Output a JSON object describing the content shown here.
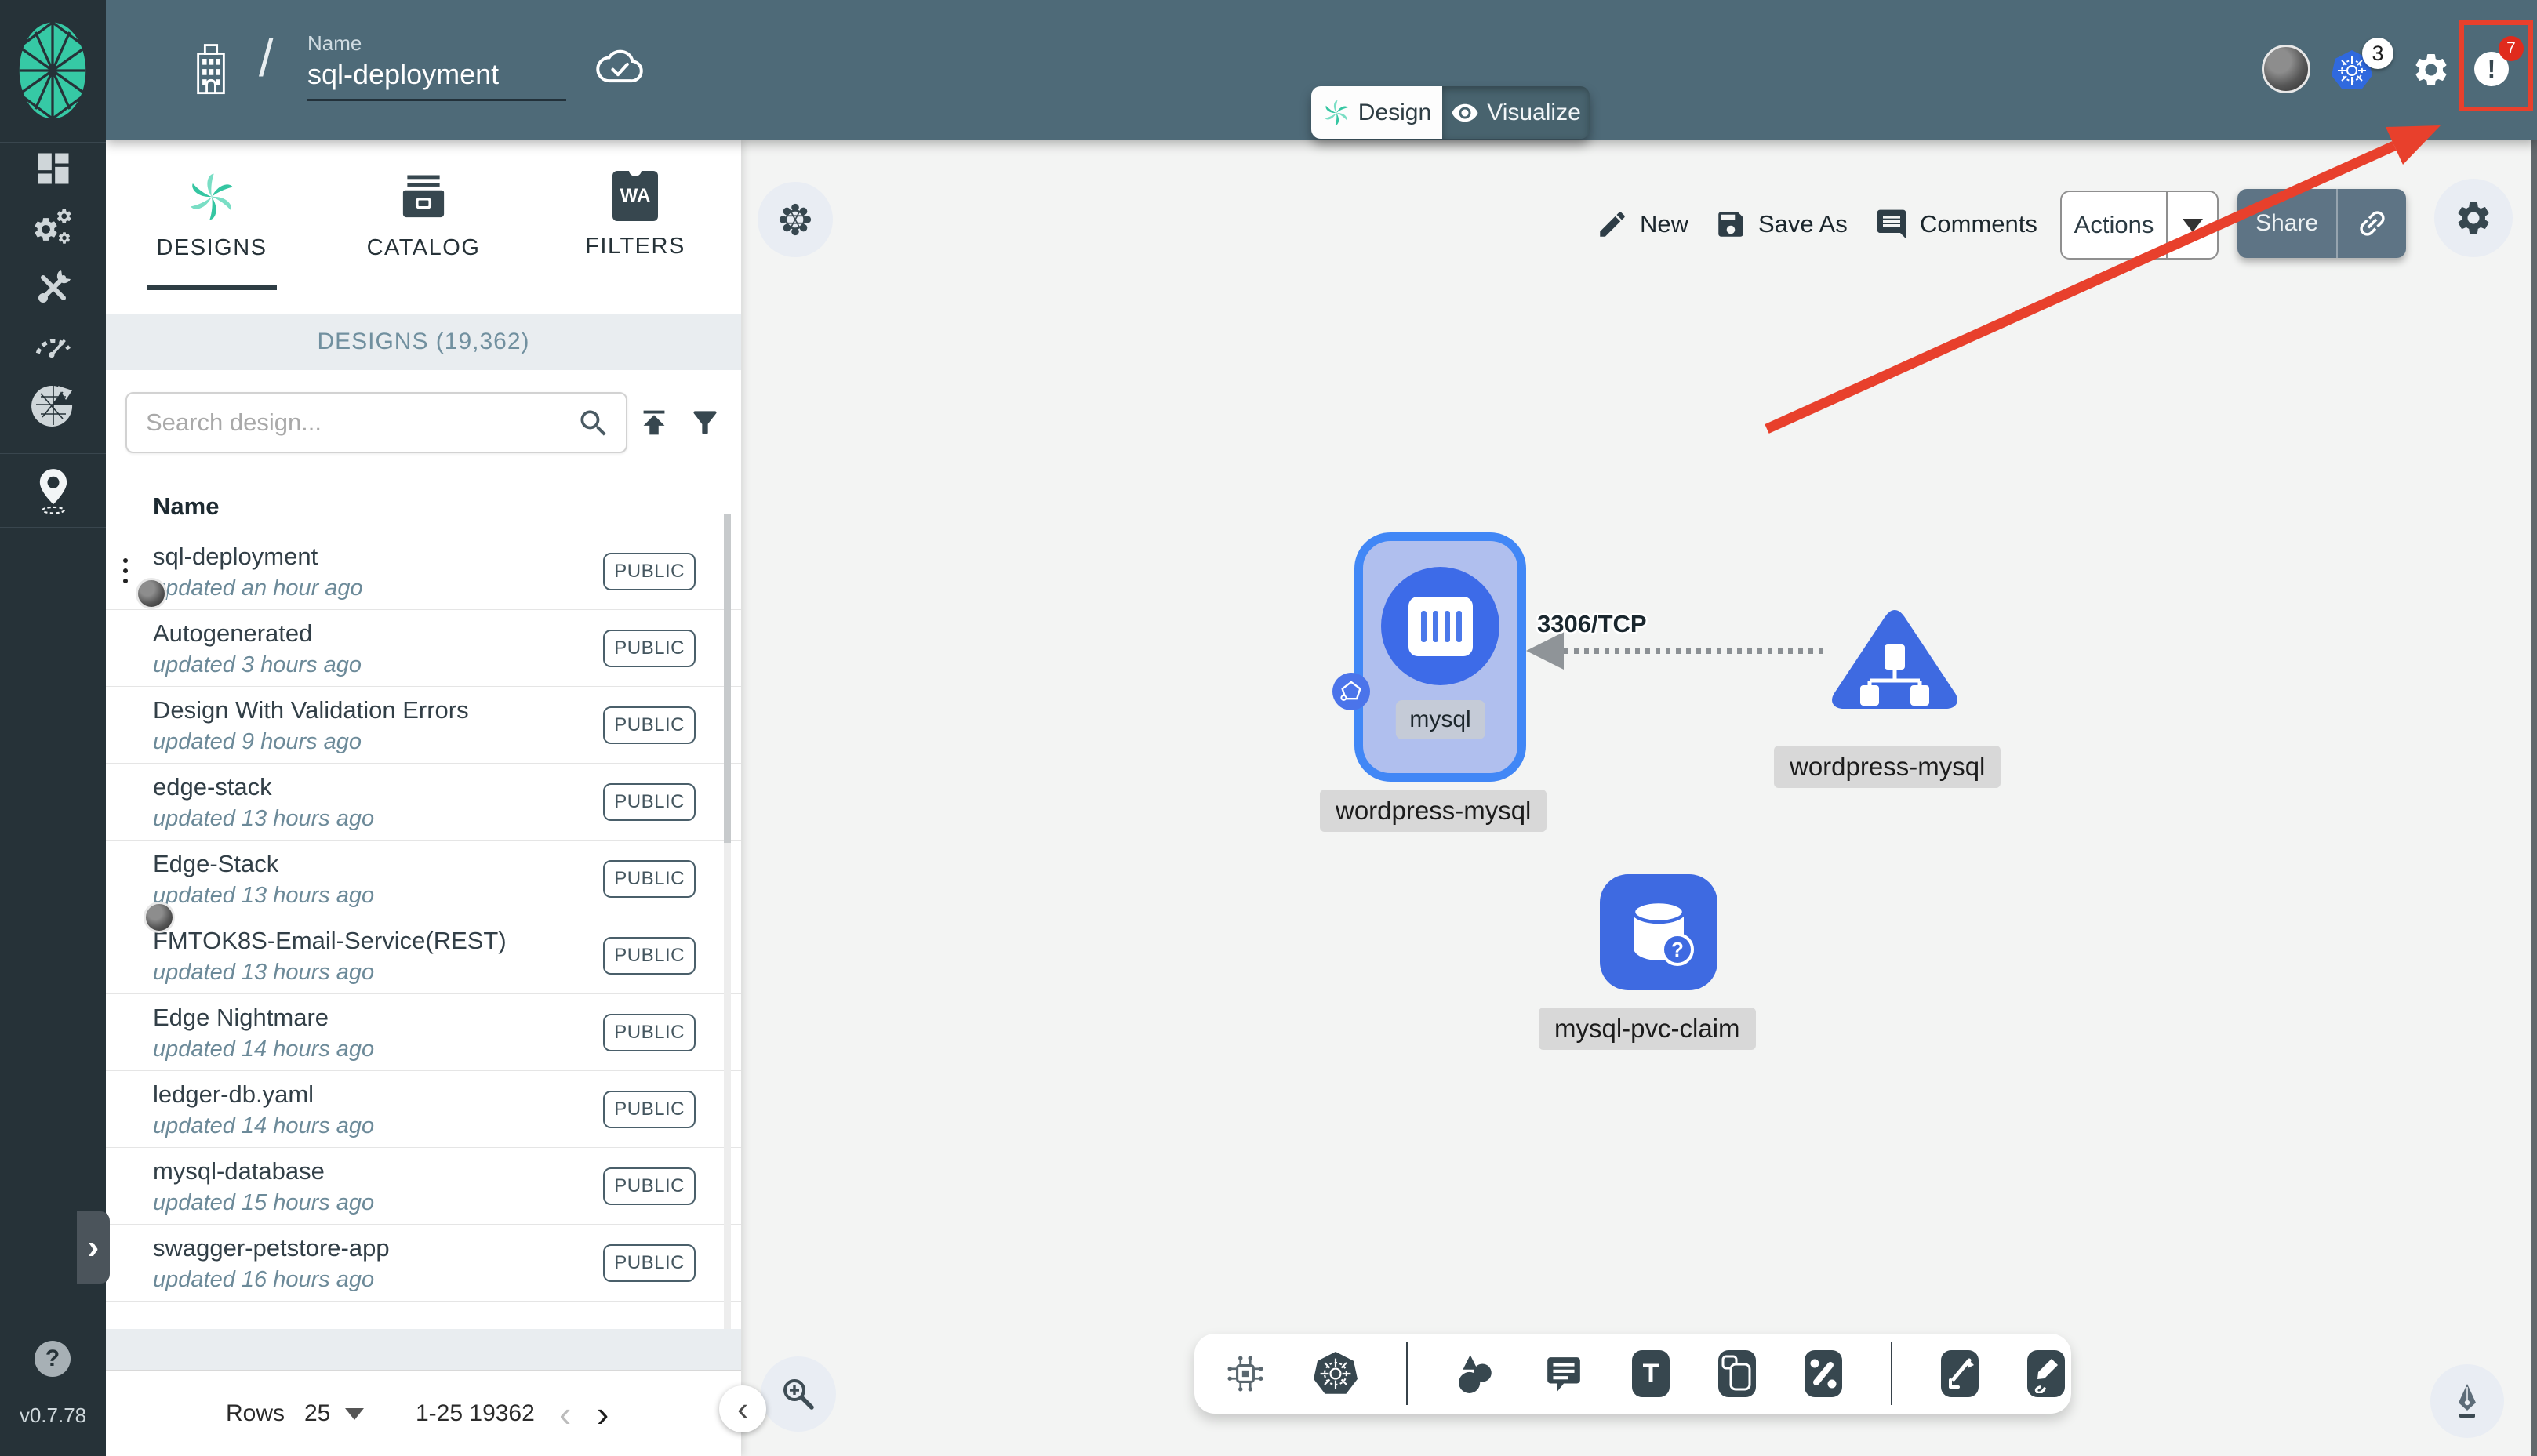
{
  "app": {
    "version": "v0.7.78"
  },
  "header": {
    "name_label": "Name",
    "name_value": "sql-deployment",
    "separator": "/",
    "k8s_count": "3",
    "alert_glyph": "!",
    "alert_count": "7"
  },
  "view_tabs": {
    "design": "Design",
    "visualize": "Visualize"
  },
  "sidebar": {
    "help_glyph": "?",
    "expand_glyph": "›"
  },
  "panel": {
    "tabs": {
      "designs": "DESIGNS",
      "catalog": "CATALOG",
      "filters": "FILTERS",
      "filters_icon_text": "WA"
    },
    "section_title": "DESIGNS (19,362)",
    "search_placeholder": "Search design...",
    "column_name": "Name",
    "rows": [
      {
        "name": "sql-deployment",
        "updated": "updated an hour ago",
        "badge": "PUBLIC"
      },
      {
        "name": "Autogenerated",
        "updated": "updated 3 hours ago",
        "badge": "PUBLIC"
      },
      {
        "name": "Design With Validation Errors",
        "updated": "updated 9 hours ago",
        "badge": "PUBLIC"
      },
      {
        "name": "edge-stack",
        "updated": "updated 13 hours ago",
        "badge": "PUBLIC"
      },
      {
        "name": "Edge-Stack",
        "updated": "updated 13 hours ago",
        "badge": "PUBLIC"
      },
      {
        "name": "FMTOK8S-Email-Service(REST)",
        "updated": "updated 13 hours ago",
        "badge": "PUBLIC"
      },
      {
        "name": "Edge Nightmare",
        "updated": "updated 14 hours ago",
        "badge": "PUBLIC"
      },
      {
        "name": "ledger-db.yaml",
        "updated": "updated 14 hours ago",
        "badge": "PUBLIC"
      },
      {
        "name": "mysql-database",
        "updated": "updated 15 hours ago",
        "badge": "PUBLIC"
      },
      {
        "name": "swagger-petstore-app",
        "updated": "updated 16 hours ago",
        "badge": "PUBLIC"
      }
    ],
    "pagination": {
      "rows_label": "Rows",
      "per_page": "25",
      "range": "1-25 19362",
      "prev": "‹",
      "next": "›"
    },
    "collapse_glyph": "‹"
  },
  "toolbar": {
    "new": "New",
    "save_as": "Save As",
    "comments": "Comments",
    "actions": "Actions",
    "share": "Share"
  },
  "canvas": {
    "edge_label": "3306/TCP",
    "mysql_label": "mysql",
    "mysql_parent_label": "wordpress-mysql",
    "service_label": "wordpress-mysql",
    "pvc_label": "mysql-pvc-claim",
    "pvc_badge": "?",
    "text_tool": "T"
  },
  "colors": {
    "header_teal": "#4e6a78",
    "sidebar_dark": "#263238",
    "accent_green": "#35c6a2",
    "node_blue": "#3e6ae1",
    "annotation_red": "#e8402c"
  }
}
